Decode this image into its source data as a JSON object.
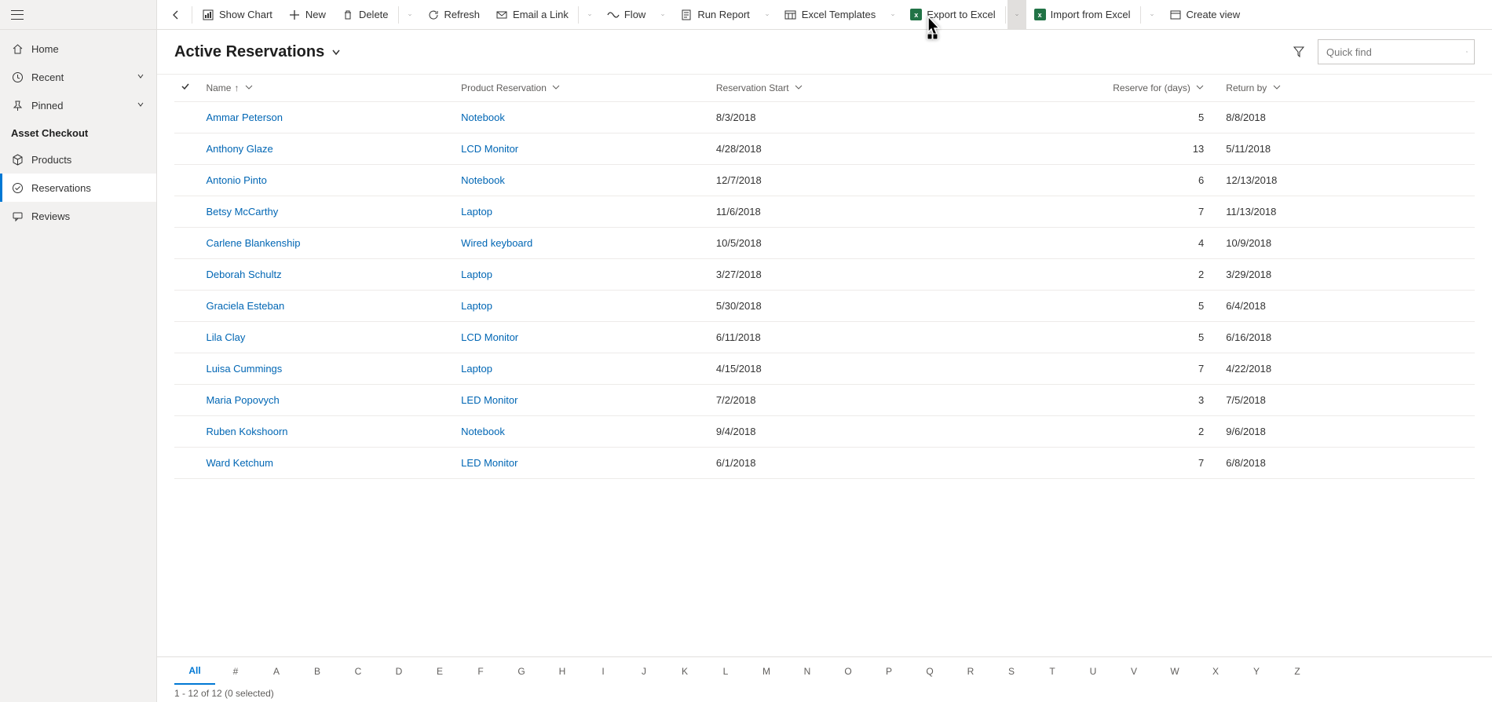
{
  "sidebar": {
    "top": [
      {
        "label": "Home",
        "icon": "home",
        "expandable": false
      },
      {
        "label": "Recent",
        "icon": "clock",
        "expandable": true
      },
      {
        "label": "Pinned",
        "icon": "pin",
        "expandable": true
      }
    ],
    "section_title": "Asset Checkout",
    "section": [
      {
        "label": "Products",
        "icon": "cube",
        "selected": false
      },
      {
        "label": "Reservations",
        "icon": "check",
        "selected": true
      },
      {
        "label": "Reviews",
        "icon": "comment",
        "selected": false
      }
    ]
  },
  "toolbar": {
    "show_chart": "Show Chart",
    "new": "New",
    "delete": "Delete",
    "refresh": "Refresh",
    "email_link": "Email a Link",
    "flow": "Flow",
    "run_report": "Run Report",
    "excel_templates": "Excel Templates",
    "export_excel": "Export to Excel",
    "import_excel": "Import from Excel",
    "create_view": "Create view"
  },
  "view": {
    "title": "Active Reservations",
    "search_placeholder": "Quick find"
  },
  "columns": {
    "name": "Name",
    "product": "Product Reservation",
    "start": "Reservation Start",
    "days": "Reserve for (days)",
    "return_by": "Return by"
  },
  "rows": [
    {
      "name": "Ammar Peterson",
      "product": "Notebook",
      "start": "8/3/2018",
      "days": 5,
      "return": "8/8/2018"
    },
    {
      "name": "Anthony Glaze",
      "product": "LCD Monitor",
      "start": "4/28/2018",
      "days": 13,
      "return": "5/11/2018"
    },
    {
      "name": "Antonio Pinto",
      "product": "Notebook",
      "start": "12/7/2018",
      "days": 6,
      "return": "12/13/2018"
    },
    {
      "name": "Betsy McCarthy",
      "product": "Laptop",
      "start": "11/6/2018",
      "days": 7,
      "return": "11/13/2018"
    },
    {
      "name": "Carlene Blankenship",
      "product": "Wired keyboard",
      "start": "10/5/2018",
      "days": 4,
      "return": "10/9/2018"
    },
    {
      "name": "Deborah Schultz",
      "product": "Laptop",
      "start": "3/27/2018",
      "days": 2,
      "return": "3/29/2018"
    },
    {
      "name": "Graciela Esteban",
      "product": "Laptop",
      "start": "5/30/2018",
      "days": 5,
      "return": "6/4/2018"
    },
    {
      "name": "Lila Clay",
      "product": "LCD Monitor",
      "start": "6/11/2018",
      "days": 5,
      "return": "6/16/2018"
    },
    {
      "name": "Luisa Cummings",
      "product": "Laptop",
      "start": "4/15/2018",
      "days": 7,
      "return": "4/22/2018"
    },
    {
      "name": "Maria Popovych",
      "product": "LED Monitor",
      "start": "7/2/2018",
      "days": 3,
      "return": "7/5/2018"
    },
    {
      "name": "Ruben Kokshoorn",
      "product": "Notebook",
      "start": "9/4/2018",
      "days": 2,
      "return": "9/6/2018"
    },
    {
      "name": "Ward Ketchum",
      "product": "LED Monitor",
      "start": "6/1/2018",
      "days": 7,
      "return": "6/8/2018"
    }
  ],
  "alphabar": [
    "All",
    "#",
    "A",
    "B",
    "C",
    "D",
    "E",
    "F",
    "G",
    "H",
    "I",
    "J",
    "K",
    "L",
    "M",
    "N",
    "O",
    "P",
    "Q",
    "R",
    "S",
    "T",
    "U",
    "V",
    "W",
    "X",
    "Y",
    "Z"
  ],
  "status": "1 - 12 of 12 (0 selected)"
}
